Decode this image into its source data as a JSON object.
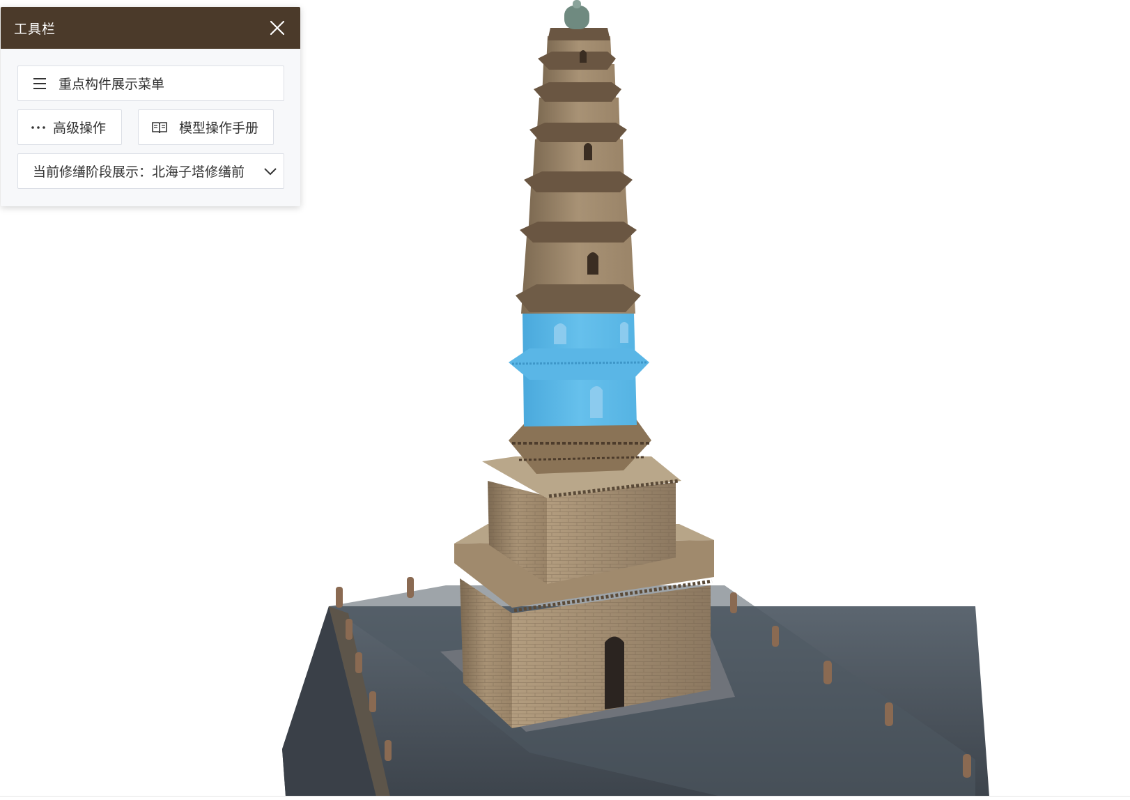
{
  "toolbar": {
    "title": "工具栏",
    "close_icon": "close-icon",
    "menu_button": {
      "label": "重点构件展示菜单",
      "icon": "list-menu-icon"
    },
    "advanced_button": {
      "label": "高级操作",
      "icon": "more-dots-icon"
    },
    "manual_button": {
      "label": "模型操作手册",
      "icon": "book-icon"
    },
    "stage_select": {
      "prefix": "当前修缮阶段展示：",
      "value": "北海子塔修缮前",
      "icon": "chevron-down-icon"
    }
  },
  "scene": {
    "subject": "pagoda-3d-model",
    "highlight_color": "#5cb8e6",
    "header_color": "#4b3a2a"
  }
}
